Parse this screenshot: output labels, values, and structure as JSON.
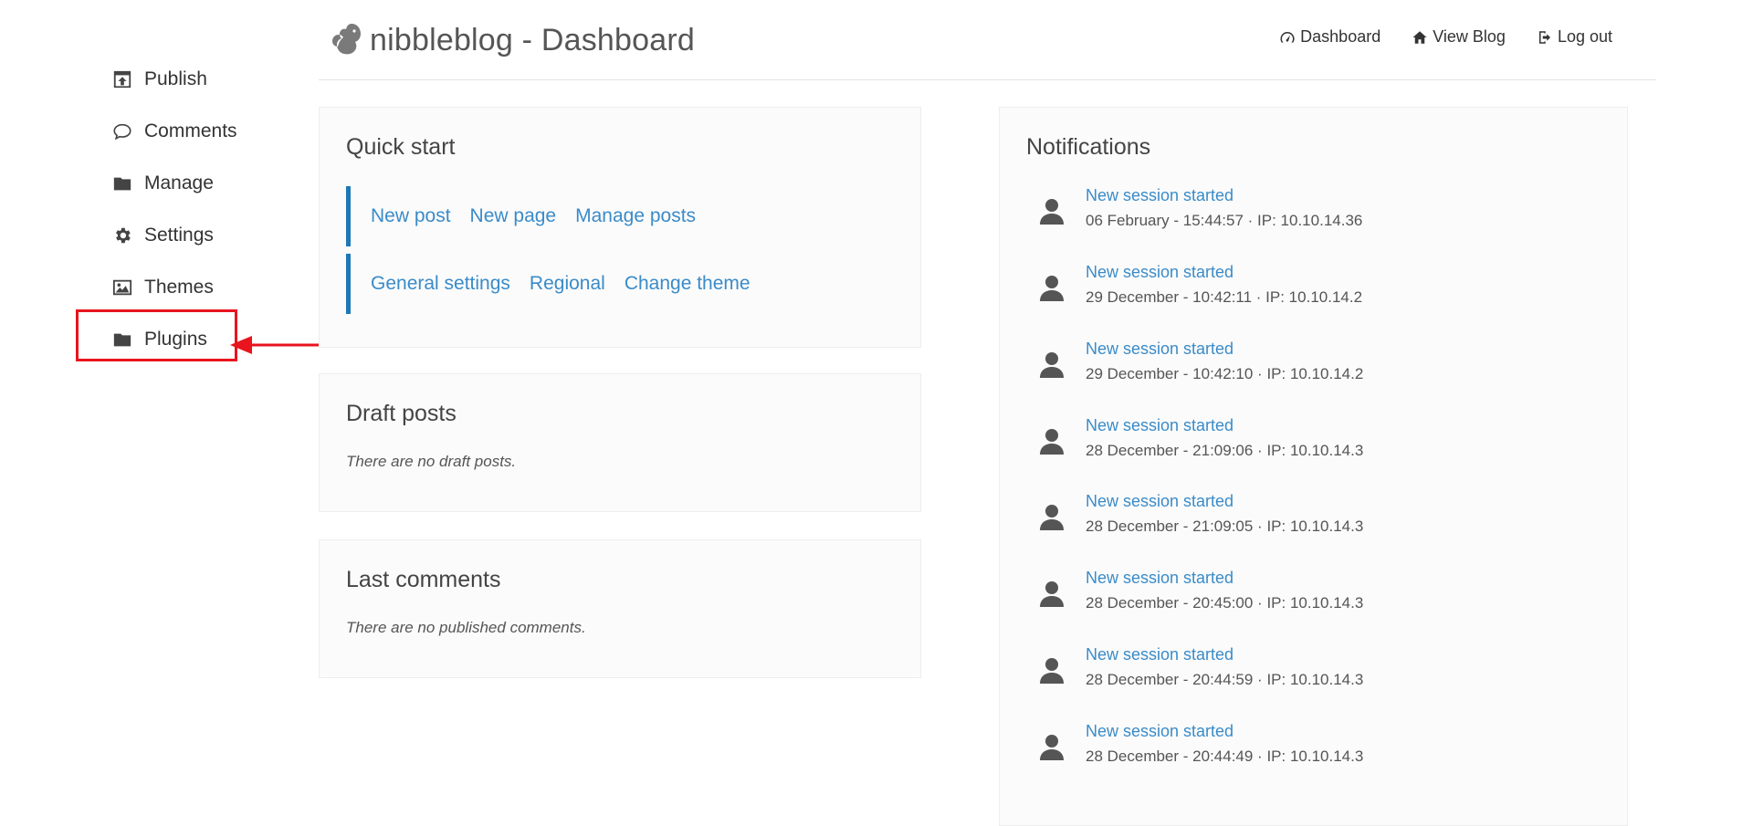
{
  "sidebar": {
    "items": [
      {
        "label": "Publish",
        "icon": "publish-icon"
      },
      {
        "label": "Comments",
        "icon": "comment-icon"
      },
      {
        "label": "Manage",
        "icon": "folder-icon"
      },
      {
        "label": "Settings",
        "icon": "gear-icon"
      },
      {
        "label": "Themes",
        "icon": "image-icon"
      },
      {
        "label": "Plugins",
        "icon": "folder-icon"
      }
    ]
  },
  "header": {
    "title": "nibbleblog - Dashboard",
    "nav": {
      "dashboard": "Dashboard",
      "view_blog": "View Blog",
      "logout": "Log out"
    }
  },
  "quick_start": {
    "title": "Quick start",
    "row1": [
      "New post",
      "New page",
      "Manage posts"
    ],
    "row2": [
      "General settings",
      "Regional",
      "Change theme"
    ]
  },
  "drafts": {
    "title": "Draft posts",
    "empty": "There are no draft posts."
  },
  "last_comments": {
    "title": "Last comments",
    "empty": "There are no published comments."
  },
  "notifications": {
    "title": "Notifications",
    "items": [
      {
        "title": "New session started",
        "meta": "06 February - 15:44:57 · IP: 10.10.14.36"
      },
      {
        "title": "New session started",
        "meta": "29 December - 10:42:11 · IP: 10.10.14.2"
      },
      {
        "title": "New session started",
        "meta": "29 December - 10:42:10 · IP: 10.10.14.2"
      },
      {
        "title": "New session started",
        "meta": "28 December - 21:09:06 · IP: 10.10.14.3"
      },
      {
        "title": "New session started",
        "meta": "28 December - 21:09:05 · IP: 10.10.14.3"
      },
      {
        "title": "New session started",
        "meta": "28 December - 20:45:00 · IP: 10.10.14.3"
      },
      {
        "title": "New session started",
        "meta": "28 December - 20:44:59 · IP: 10.10.14.3"
      },
      {
        "title": "New session started",
        "meta": "28 December - 20:44:49 · IP: 10.10.14.3"
      }
    ]
  },
  "colors": {
    "link": "#3a8bc8",
    "accent_bar": "#1e78b4",
    "annotation": "#e8141e"
  }
}
